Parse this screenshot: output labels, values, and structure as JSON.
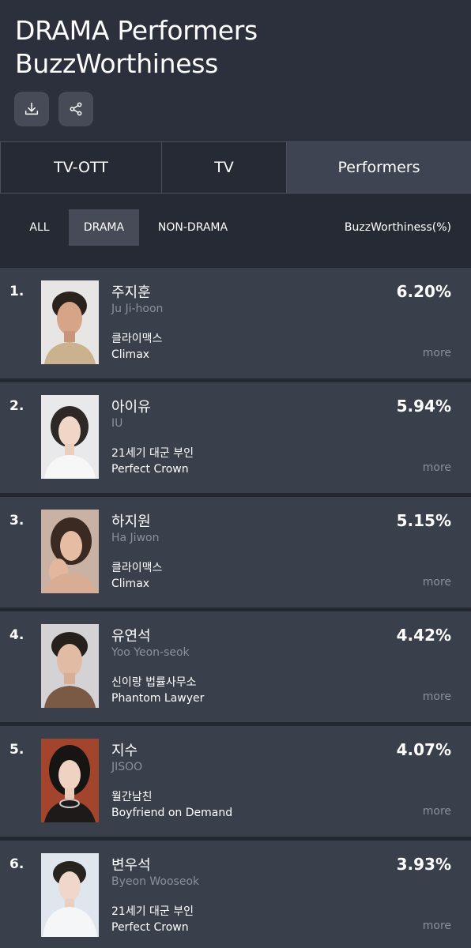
{
  "header": {
    "title_line1": "DRAMA Performers",
    "title_line2": "BuzzWorthiness",
    "download_icon": "download-icon",
    "share_icon": "share-icon"
  },
  "tabs": [
    {
      "label": "TV-OTT",
      "active": false
    },
    {
      "label": "TV",
      "active": false
    },
    {
      "label": "Performers",
      "active": true
    }
  ],
  "filters": {
    "chips": [
      {
        "label": "ALL",
        "active": false
      },
      {
        "label": "DRAMA",
        "active": true
      },
      {
        "label": "NON-DRAMA",
        "active": false
      }
    ],
    "metric_label": "BuzzWorthiness(%)"
  },
  "ranking": [
    {
      "rank": "1.",
      "name_ko": "주지훈",
      "name_en": "Ju Ji-hoon",
      "show_ko": "클라이맥스",
      "show_en": "Climax",
      "pct": "6.20%",
      "more": "more"
    },
    {
      "rank": "2.",
      "name_ko": "아이유",
      "name_en": "IU",
      "show_ko": "21세기 대군 부인",
      "show_en": "Perfect Crown",
      "pct": "5.94%",
      "more": "more"
    },
    {
      "rank": "3.",
      "name_ko": "하지원",
      "name_en": "Ha Jiwon",
      "show_ko": "클라이맥스",
      "show_en": "Climax",
      "pct": "5.15%",
      "more": "more"
    },
    {
      "rank": "4.",
      "name_ko": "유연석",
      "name_en": "Yoo Yeon-seok",
      "show_ko": "신이랑 법률사무소",
      "show_en": "Phantom Lawyer",
      "pct": "4.42%",
      "more": "more"
    },
    {
      "rank": "5.",
      "name_ko": "지수",
      "name_en": "JISOO",
      "show_ko": "월간남친",
      "show_en": "Boyfriend on Demand",
      "pct": "4.07%",
      "more": "more"
    },
    {
      "rank": "6.",
      "name_ko": "변우석",
      "name_en": "Byeon Wooseok",
      "show_ko": "21세기 대군 부인",
      "show_en": "Perfect Crown",
      "pct": "3.93%",
      "more": "more"
    }
  ]
}
